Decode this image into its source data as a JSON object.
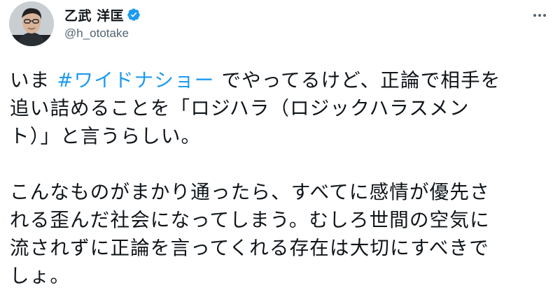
{
  "author": {
    "display_name": "乙武 洋匡",
    "handle": "@h_ototake",
    "verified": true
  },
  "icons": {
    "verified": "verified-badge-icon",
    "more": "more-options-icon",
    "avatar": "profile-photo"
  },
  "colors": {
    "link": "#1d9bf0",
    "text": "#0f1419",
    "secondary": "#536471"
  },
  "tweet": {
    "p1_line1_prefix": "いま ",
    "p1_hashtag": "#ワイドナショー",
    "p1_line1_suffix": " でやってるけど、正論で相手を",
    "p1_line2": "追い詰めることを「ロジハラ（ロジックハラスメン",
    "p1_line3": "ト）」と言うらしい。",
    "p2_line1": "こんなものがまかり通ったら、すべてに感情が優先さ",
    "p2_line2": "れる歪んだ社会になってしまう。むしろ世間の空気に",
    "p2_line3": "流されずに正論を言ってくれる存在は大切にすべきで",
    "p2_line4": "しょ。"
  }
}
